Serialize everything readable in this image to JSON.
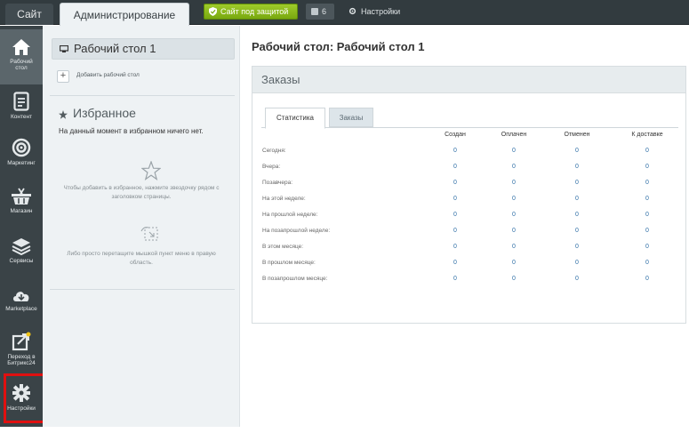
{
  "topbar": {
    "site_tab": "Сайт",
    "admin_tab": "Администрирование",
    "protected_label": "Сайт под защитой",
    "notifications_count": "6",
    "settings_label": "Настройки"
  },
  "leftnav": {
    "items": [
      {
        "label_line1": "Рабочий",
        "label_line2": "стол",
        "icon": "home-icon",
        "active": true
      },
      {
        "label_line1": "Контент",
        "label_line2": "",
        "icon": "document-icon"
      },
      {
        "label_line1": "Маркетинг",
        "label_line2": "",
        "icon": "target-icon"
      },
      {
        "label_line1": "Магазин",
        "label_line2": "",
        "icon": "basket-icon"
      },
      {
        "label_line1": "Сервисы",
        "label_line2": "",
        "icon": "layers-icon"
      },
      {
        "label_line1": "Marketplace",
        "label_line2": "",
        "icon": "cloud-icon"
      },
      {
        "label_line1": "Переход в",
        "label_line2": "Битрикс24",
        "icon": "export-icon"
      },
      {
        "label_line1": "Настройки",
        "label_line2": "",
        "icon": "gear-icon"
      }
    ]
  },
  "panel": {
    "desktop_title": "Рабочий стол 1",
    "add_desktop": "Добавить рабочий стол",
    "favorites_title": "Избранное",
    "favorites_empty": "На данный момент в избранном ничего нет.",
    "hint_star": "Чтобы добавить в избранное, нажмите звездочку рядом с заголовком страницы.",
    "hint_drag": "Либо просто перетащите мышкой пункт меню в правую область."
  },
  "main": {
    "title": "Рабочий стол: Рабочий стол 1",
    "card_title": "Заказы",
    "tabs": [
      "Статистика",
      "Заказы"
    ],
    "columns": [
      "Создан",
      "Оплачен",
      "Отменен",
      "К доставке"
    ],
    "rows": [
      {
        "label": "Сегодня:",
        "values": [
          "0",
          "0",
          "0",
          "0"
        ]
      },
      {
        "label": "Вчера:",
        "values": [
          "0",
          "0",
          "0",
          "0"
        ]
      },
      {
        "label": "Позавчера:",
        "values": [
          "0",
          "0",
          "0",
          "0"
        ]
      },
      {
        "label": "На этой неделе:",
        "values": [
          "0",
          "0",
          "0",
          "0"
        ]
      },
      {
        "label": "На прошлой неделе:",
        "values": [
          "0",
          "0",
          "0",
          "0"
        ]
      },
      {
        "label": "На позапрошлой неделе:",
        "values": [
          "0",
          "0",
          "0",
          "0"
        ]
      },
      {
        "label": "В этом месяце:",
        "values": [
          "0",
          "0",
          "0",
          "0"
        ]
      },
      {
        "label": "В прошлом месяце:",
        "values": [
          "0",
          "0",
          "0",
          "0"
        ]
      },
      {
        "label": "В позапрошлом месяце:",
        "values": [
          "0",
          "0",
          "0",
          "0"
        ]
      }
    ]
  }
}
